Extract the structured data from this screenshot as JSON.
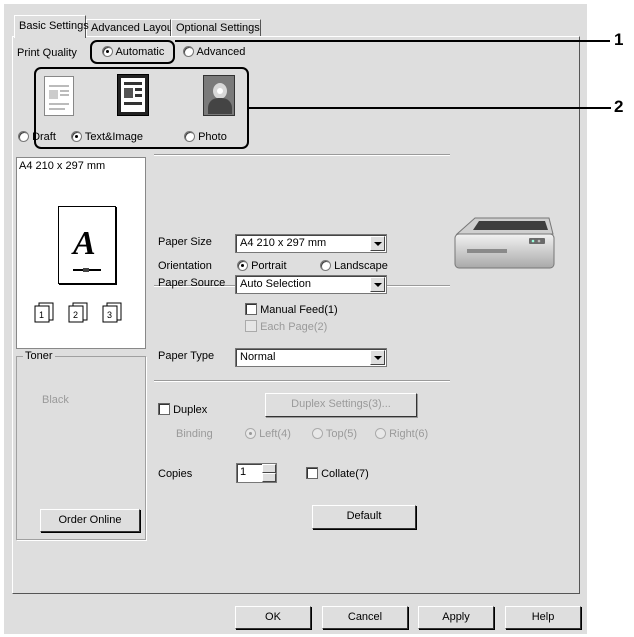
{
  "tabs": [
    {
      "label": "Basic Settings",
      "active": true
    },
    {
      "label": "Advanced Layout",
      "active": false
    },
    {
      "label": "Optional Settings",
      "active": false
    }
  ],
  "print_quality": {
    "label": "Print Quality",
    "options": [
      {
        "label": "Automatic",
        "selected": true
      },
      {
        "label": "Advanced",
        "selected": false
      }
    ]
  },
  "quality_modes": [
    {
      "label": "Draft",
      "selected": false,
      "icon": "draft-document-icon"
    },
    {
      "label": "Text&Image",
      "selected": true,
      "icon": "text-image-document-icon"
    },
    {
      "label": "Photo",
      "selected": false,
      "icon": "photo-icon"
    }
  ],
  "callouts": {
    "one": "1",
    "two": "2"
  },
  "preview": {
    "size_label": "A4 210 x 297 mm",
    "letter": "A",
    "toner_title": "Toner",
    "toner_color": "Black",
    "order_button": "Order Online"
  },
  "paper_size": {
    "label": "Paper Size",
    "value": "A4 210 x 297 mm"
  },
  "orientation": {
    "label": "Orientation",
    "options": [
      {
        "label": "Portrait",
        "selected": true
      },
      {
        "label": "Landscape",
        "selected": false
      }
    ]
  },
  "paper_source": {
    "label": "Paper Source",
    "value": "Auto Selection",
    "manual_feed": "Manual Feed(1)",
    "each_page": "Each Page(2)"
  },
  "paper_type": {
    "label": "Paper Type",
    "value": "Normal"
  },
  "duplex": {
    "label": "Duplex",
    "settings_button": "Duplex Settings(3)...",
    "binding_label": "Binding",
    "binding_options": [
      {
        "label": "Left(4)",
        "selected": true
      },
      {
        "label": "Top(5)",
        "selected": false
      },
      {
        "label": "Right(6)",
        "selected": false
      }
    ]
  },
  "copies": {
    "label": "Copies",
    "value": "1",
    "collate": "Collate(7)"
  },
  "default_button": "Default",
  "footer": {
    "ok": "OK",
    "cancel": "Cancel",
    "apply": "Apply",
    "help": "Help"
  }
}
